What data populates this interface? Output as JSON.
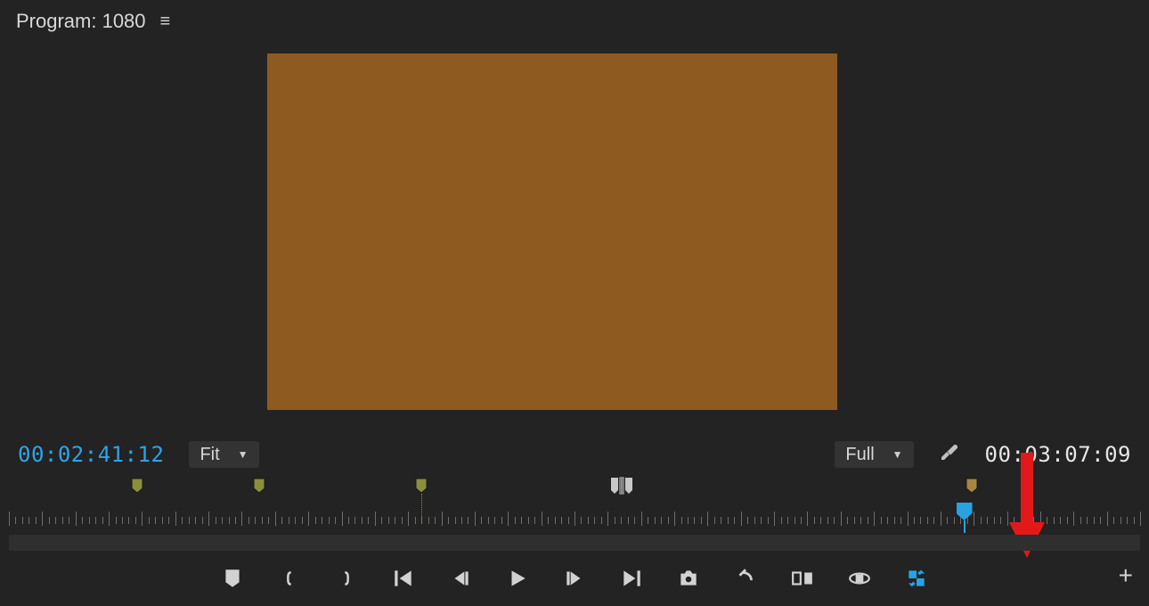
{
  "header": {
    "title": "Program: 1080"
  },
  "controls": {
    "timecode_in": "00:02:41:12",
    "zoom_label": "Fit",
    "resolution_label": "Full",
    "duration": "00:03:07:09"
  },
  "markers": [
    {
      "pos_pct": 11.5,
      "color": "#8a8f3c"
    },
    {
      "pos_pct": 22.5,
      "color": "#8a8f3c"
    },
    {
      "pos_pct": 37.0,
      "color": "#8a8f3c",
      "playline": true
    },
    {
      "pos_pct": 86.5,
      "color": "#a88640"
    }
  ],
  "inout_icon_pos_pct": 55.0,
  "playhead_pos_pct": 85.8,
  "transport_buttons": [
    "mark-in",
    "mark-out-open",
    "mark-out-close",
    "go-to-in",
    "step-back",
    "play",
    "step-forward",
    "go-to-out",
    "export-frame",
    "undo",
    "comparison-view",
    "vr-toggle",
    "loop-playback"
  ],
  "icons": {
    "menu": "≡",
    "wrench": "wrench",
    "plus": "+"
  },
  "colors": {
    "accent_blue": "#27a3e2",
    "preview_fill": "#8e5a1f",
    "annotation_red": "#e31919"
  }
}
